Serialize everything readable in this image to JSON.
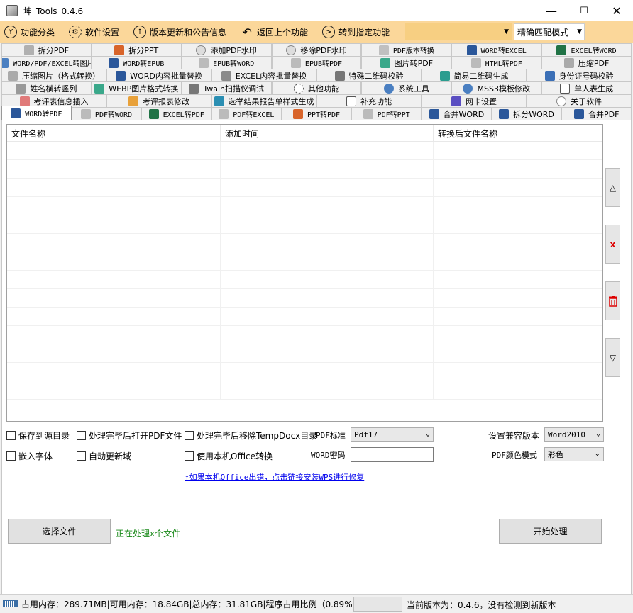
{
  "window": {
    "title": "坤_Tools_0.4.6",
    "minimize": "—",
    "maximize": "☐",
    "close": "✕"
  },
  "toolbar": {
    "items": [
      {
        "label": "功能分类",
        "icon": "Y"
      },
      {
        "label": "软件设置",
        "icon": "⚙"
      },
      {
        "label": "版本更新和公告信息",
        "icon": "↑"
      },
      {
        "label": "返回上个功能",
        "icon": "↶"
      },
      {
        "label": "转到指定功能",
        "icon": ">"
      }
    ],
    "combo_value": "",
    "match_mode": "精确匹配模式"
  },
  "tabs": {
    "row1": [
      "拆分PDF",
      "拆分PPT",
      "添加PDF水印",
      "移除PDF水印",
      "PDF版本转换",
      "WORD转EXCEL",
      "EXCEL转WORD"
    ],
    "row2": [
      "WORD/PDF/EXCEL转图片",
      "WORD转EPUB",
      "EPUB转WORD",
      "EPUB转PDF",
      "图片转PDF",
      "HTML转PDF",
      "压缩PDF"
    ],
    "row3": [
      "压缩图片（格式转换）",
      "WORD内容批量替换",
      "EXCEL内容批量替换",
      "特殊二维码校验",
      "简易二维码生成",
      "身份证号码校验"
    ],
    "row4": [
      "姓名横转竖列",
      "WEBP图片格式转换",
      "Twain扫描仪调试",
      "其他功能",
      "系统工具",
      "MSS3模板修改",
      "单人表生成"
    ],
    "row5": [
      "考评表信息插入",
      "考评报表修改",
      "选举结果报告单样式生成",
      "补充功能",
      "网卡设置",
      "关于软件"
    ],
    "row6": [
      "WORD转PDF",
      "PDF转WORD",
      "EXCEL转PDF",
      "PDF转EXCEL",
      "PPT转PDF",
      "PDF转PPT",
      "合并WORD",
      "拆分WORD",
      "合并PDF"
    ]
  },
  "grid": {
    "columns": [
      "文件名称",
      "添加时间",
      "转换后文件名称"
    ]
  },
  "side_buttons": {
    "up": "△",
    "remove": "x",
    "clear": "🗑",
    "down": "▽"
  },
  "options": {
    "save_to_source": "保存到源目录",
    "open_pdf_after": "处理完毕后打开PDF文件",
    "remove_tempdocx": "处理完毕后移除TempDocx目录",
    "pdf_standard_label": "PDF标准",
    "pdf_standard_value": "Pdf17",
    "compat_label": "设置兼容版本",
    "compat_value": "Word2010",
    "embed_fonts": "嵌入字体",
    "auto_update_fields": "自动更新域",
    "use_local_office": "使用本机Office转换",
    "word_password_label": "WORD密码",
    "word_password_value": "",
    "pdf_color_label": "PDF颜色模式",
    "pdf_color_value": "彩色"
  },
  "link_text": "↑如果本机Office出错，点击链接安装WPS进行修复",
  "actions": {
    "select_files": "选择文件",
    "processing_status": "正在处理x个文件",
    "start": "开始处理"
  },
  "statusbar": {
    "memory": "占用内存：289.71MB|可用内存：18.84GB|总内存：31.81GB|程序占用比例（0.89%）",
    "version": "当前版本为：0.4.6，没有检测到新版本"
  }
}
